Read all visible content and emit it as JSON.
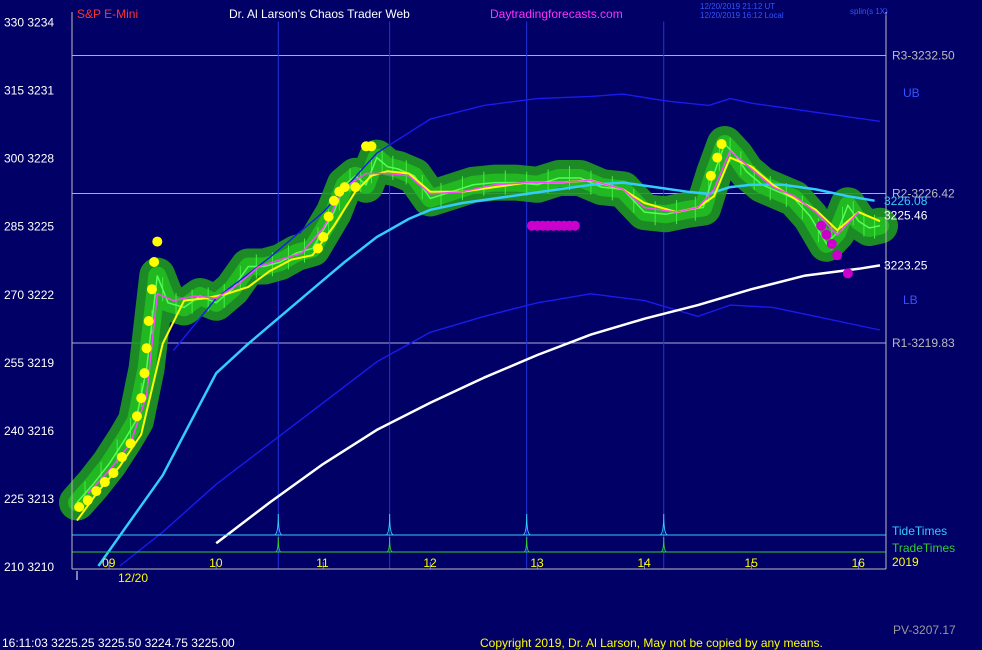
{
  "header": {
    "instrument": "S&P E-Mini",
    "site_title": "Dr. Al Larson's Chaos Trader Web",
    "site_url": "Daytradingforecasts.com",
    "timestamp_utc": "12/20/2019 21:12 UT",
    "timestamp_local": "12/20/2019 16:12 Local",
    "spline": "splin(s 1X)"
  },
  "footer": {
    "ohlc": "16:11:03  3225.25 3225.50 3224.75 3225.00",
    "copyright": "Copyright 2019, Dr. Al Larson, May not be copied by any means.",
    "pv": "PV-3207.17"
  },
  "colors": {
    "background": "#000066",
    "price": "#00cc00",
    "yellow_line": "#ffff00",
    "magenta_line": "#ff44ff",
    "cyan_line": "#33ccff",
    "white_line": "#ffffff",
    "band_line": "#0000ee",
    "title_red": "#ff3333",
    "site_magenta": "#ff33ff"
  },
  "chart_data": {
    "type": "line",
    "ylim": [
      3210,
      3234
    ],
    "xlim": [
      8.7,
      16.2
    ],
    "y_ticks": [
      {
        "value": 3234,
        "label": "330  3234"
      },
      {
        "value": 3231,
        "label": "315  3231"
      },
      {
        "value": 3228,
        "label": "300  3228"
      },
      {
        "value": 3225,
        "label": "285  3225"
      },
      {
        "value": 3222,
        "label": "270  3222"
      },
      {
        "value": 3219,
        "label": "255  3219"
      },
      {
        "value": 3216,
        "label": "240  3216"
      },
      {
        "value": 3213,
        "label": "225  3213"
      },
      {
        "value": 3210,
        "label": "210  3210"
      }
    ],
    "x_ticks": [
      {
        "value": 9,
        "label": "09"
      },
      {
        "value": 10,
        "label": "10"
      },
      {
        "value": 11,
        "label": "11"
      },
      {
        "value": 12,
        "label": "12"
      },
      {
        "value": 13,
        "label": "13"
      },
      {
        "value": 14,
        "label": "14"
      },
      {
        "value": 15,
        "label": "15"
      },
      {
        "value": 16,
        "label": "16"
      }
    ],
    "date_label": "12/20",
    "year_label": "2019",
    "levels": [
      {
        "name": "R3",
        "value": 3232.5,
        "label": "R3-3232.50"
      },
      {
        "name": "R2",
        "value": 3226.42,
        "label": "R2-3226.42"
      },
      {
        "name": "R1",
        "value": 3219.83,
        "label": "R1-3219.83"
      }
    ],
    "band_labels": {
      "upper": "UB",
      "lower": "LB"
    },
    "value_labels": [
      {
        "series": "cyan",
        "value": 3226.08,
        "label": "3226.08"
      },
      {
        "series": "yellow",
        "value": 3225.46,
        "label": "3225.46"
      },
      {
        "series": "white",
        "value": 3223.25,
        "label": "3223.25"
      }
    ],
    "vertical_times": [
      10.58,
      11.62,
      12.9,
      14.18
    ],
    "tide_label": "TideTimes",
    "trade_label": "TradeTimes",
    "series": [
      {
        "key": "price",
        "x": [
          8.7,
          8.85,
          9.0,
          9.15,
          9.25,
          9.35,
          9.45,
          9.55,
          9.7,
          9.85,
          10.0,
          10.15,
          10.3,
          10.45,
          10.6,
          10.75,
          10.9,
          11.0,
          11.1,
          11.2,
          11.3,
          11.4,
          11.5,
          11.6,
          11.7,
          11.85,
          12.0,
          12.2,
          12.4,
          12.6,
          12.8,
          13.0,
          13.2,
          13.4,
          13.6,
          13.8,
          14.0,
          14.2,
          14.4,
          14.55,
          14.65,
          14.75,
          14.85,
          14.95,
          15.1,
          15.25,
          15.4,
          15.55,
          15.7,
          15.8,
          15.9,
          16.0,
          16.1,
          16.2
        ],
        "y": [
          3212.8,
          3213.6,
          3214.5,
          3215.6,
          3216.4,
          3218.7,
          3222.8,
          3221.6,
          3221.4,
          3221.9,
          3221.6,
          3222.2,
          3223.2,
          3223.2,
          3223.4,
          3223.8,
          3224.0,
          3224.8,
          3225.6,
          3226.8,
          3227.2,
          3226.8,
          3228.0,
          3227.6,
          3227.5,
          3227.2,
          3226.2,
          3226.5,
          3226.8,
          3226.9,
          3226.9,
          3226.8,
          3227.1,
          3227.1,
          3226.7,
          3226.6,
          3225.6,
          3225.5,
          3225.7,
          3225.8,
          3227.3,
          3228.6,
          3228.1,
          3227.4,
          3226.8,
          3226.5,
          3226.2,
          3225.4,
          3224.2,
          3224.7,
          3225.9,
          3225.2,
          3224.9,
          3225.0
        ]
      },
      {
        "key": "yellow",
        "x": [
          8.7,
          8.9,
          9.1,
          9.3,
          9.5,
          9.7,
          9.9,
          10.1,
          10.3,
          10.5,
          10.7,
          10.9,
          11.1,
          11.3,
          11.45,
          11.6,
          11.8,
          12.0,
          12.3,
          12.6,
          12.9,
          13.2,
          13.5,
          13.8,
          14.0,
          14.3,
          14.5,
          14.65,
          14.8,
          15.0,
          15.2,
          15.4,
          15.6,
          15.8,
          16.0,
          16.2
        ],
        "y": [
          3212.0,
          3213.3,
          3214.4,
          3215.8,
          3219.8,
          3221.7,
          3221.8,
          3222.0,
          3222.3,
          3223.0,
          3223.5,
          3223.7,
          3225.0,
          3226.5,
          3227.2,
          3227.4,
          3227.3,
          3226.5,
          3226.5,
          3226.7,
          3226.9,
          3226.9,
          3227.0,
          3226.6,
          3226.0,
          3225.6,
          3225.8,
          3226.3,
          3228.0,
          3227.6,
          3226.8,
          3226.2,
          3225.7,
          3224.8,
          3225.6,
          3225.2
        ]
      },
      {
        "key": "magenta",
        "x": [
          8.8,
          9.0,
          9.2,
          9.35,
          9.45,
          9.6,
          9.8,
          10.0,
          10.2,
          10.4,
          10.6,
          10.8,
          11.0,
          11.2,
          11.4,
          11.6,
          11.8,
          12.0,
          12.3,
          12.6,
          12.9,
          13.2,
          13.5,
          13.8,
          14.0,
          14.3,
          14.5,
          14.65,
          14.8,
          15.0,
          15.2,
          15.4,
          15.6,
          15.8,
          16.0
        ],
        "y": [
          3213.2,
          3214.2,
          3215.4,
          3217.5,
          3222.0,
          3221.7,
          3221.9,
          3221.8,
          3222.4,
          3223.2,
          3223.5,
          3223.8,
          3224.9,
          3226.7,
          3227.3,
          3227.3,
          3227.2,
          3226.4,
          3226.5,
          3226.8,
          3226.9,
          3226.9,
          3227.0,
          3226.6,
          3225.8,
          3225.6,
          3225.8,
          3226.6,
          3228.3,
          3227.5,
          3226.7,
          3226.3,
          3225.6,
          3224.6,
          3225.6
        ]
      },
      {
        "key": "cyan",
        "x": [
          8.9,
          9.2,
          9.5,
          9.8,
          10.0,
          10.3,
          10.6,
          10.9,
          11.2,
          11.5,
          11.8,
          12.0,
          12.3,
          12.6,
          12.9,
          13.2,
          13.5,
          13.8,
          14.1,
          14.4,
          14.6,
          14.8,
          15.0,
          15.3,
          15.6,
          15.9,
          16.15
        ],
        "y": [
          3210.0,
          3212.0,
          3214.0,
          3216.7,
          3218.5,
          3219.8,
          3221.0,
          3222.2,
          3223.4,
          3224.5,
          3225.3,
          3225.7,
          3226.0,
          3226.2,
          3226.4,
          3226.6,
          3226.8,
          3226.9,
          3226.7,
          3226.5,
          3226.4,
          3226.7,
          3226.8,
          3226.8,
          3226.6,
          3226.3,
          3226.1
        ]
      },
      {
        "key": "white",
        "x": [
          10.0,
          10.5,
          11.0,
          11.5,
          12.0,
          12.5,
          13.0,
          13.5,
          14.0,
          14.5,
          15.0,
          15.5,
          16.0,
          16.2
        ],
        "y": [
          3211.0,
          3212.8,
          3214.5,
          3216.0,
          3217.2,
          3218.3,
          3219.3,
          3220.2,
          3220.9,
          3221.5,
          3222.2,
          3222.8,
          3223.1,
          3223.25
        ]
      },
      {
        "key": "upper_band",
        "x": [
          9.6,
          10.0,
          10.5,
          11.0,
          11.5,
          12.0,
          12.5,
          13.0,
          13.5,
          13.8,
          14.2,
          14.6,
          14.8,
          15.0,
          15.3,
          15.6,
          15.9,
          16.2
        ],
        "y": [
          3219.5,
          3221.8,
          3223.6,
          3225.6,
          3228.2,
          3229.7,
          3230.3,
          3230.6,
          3230.7,
          3230.8,
          3230.5,
          3230.3,
          3230.6,
          3230.4,
          3230.2,
          3230.0,
          3229.8,
          3229.6
        ]
      },
      {
        "key": "lower_band",
        "x": [
          9.1,
          9.5,
          10.0,
          10.5,
          11.0,
          11.5,
          12.0,
          12.5,
          13.0,
          13.5,
          14.0,
          14.5,
          14.8,
          15.2,
          15.6,
          16.0,
          16.2
        ],
        "y": [
          3210.0,
          3211.5,
          3213.6,
          3215.4,
          3217.2,
          3219.0,
          3220.3,
          3221.0,
          3221.6,
          3222.0,
          3221.7,
          3221.0,
          3221.5,
          3221.4,
          3221.0,
          3220.6,
          3220.4
        ]
      }
    ],
    "yellow_dots": {
      "x": [
        8.72,
        8.8,
        8.88,
        8.96,
        9.04,
        9.12,
        9.2,
        9.26,
        9.3,
        9.33,
        9.35,
        9.37,
        9.4,
        9.42,
        9.45,
        10.95,
        11.0,
        11.05,
        11.1,
        11.15,
        11.2,
        11.3,
        11.4,
        11.45,
        14.62,
        14.68,
        14.72
      ],
      "y": [
        3212.6,
        3212.9,
        3213.3,
        3213.7,
        3214.1,
        3214.8,
        3215.4,
        3216.6,
        3217.4,
        3218.5,
        3219.6,
        3220.8,
        3222.2,
        3223.4,
        3224.3,
        3224.0,
        3224.5,
        3225.4,
        3226.1,
        3226.5,
        3226.7,
        3226.7,
        3228.5,
        3228.5,
        3227.2,
        3228.0,
        3228.6
      ]
    },
    "magenta_dots": {
      "x": [
        12.95,
        13.0,
        13.05,
        13.1,
        13.15,
        13.2,
        13.25,
        13.3,
        13.35,
        15.65,
        15.7,
        15.75,
        15.8,
        15.9
      ],
      "y": [
        3225.0,
        3225.0,
        3225.0,
        3225.0,
        3225.0,
        3225.0,
        3225.0,
        3225.0,
        3225.0,
        3225.0,
        3224.6,
        3224.2,
        3223.7,
        3222.9
      ]
    }
  }
}
